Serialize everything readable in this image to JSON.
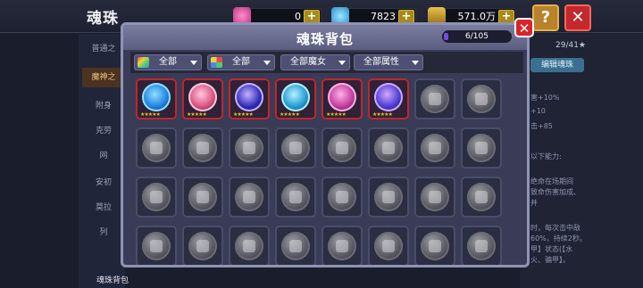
{
  "page": {
    "title": "魂珠"
  },
  "resources": [
    {
      "name": "gem-icon",
      "value": "0",
      "color": "#e05aa8"
    },
    {
      "name": "diamond-icon",
      "value": "7823",
      "color": "#4ac2e8"
    },
    {
      "name": "chest-icon",
      "value": "571.0万",
      "color": "#c79a2a"
    }
  ],
  "top_buttons": {
    "help": "?",
    "close": "✕"
  },
  "sidebar": {
    "items": [
      "普通之",
      "魔神之",
      "附身",
      "克劳",
      "网",
      "安初",
      "莫拉",
      "列"
    ],
    "active_index": 1
  },
  "right_panel": {
    "count": "29/41★",
    "button": "编辑魂珠",
    "lines": [
      "害+10%",
      "+10",
      "击+85",
      "以下能力:",
      "绝命在场期间",
      "致命伤害加成、",
      "并",
      "时，每次击中敌",
      "60%，持续2秒。",
      "甲】状态(【水",
      "火、骗甲】。"
    ]
  },
  "bottom_label": "魂珠背包",
  "modal": {
    "title": "魂珠背包",
    "capacity": "6/105",
    "close_label": "✕",
    "filters": [
      {
        "label": "全部",
        "swatch": "rainbow"
      },
      {
        "label": "全部",
        "swatch": "elements"
      },
      {
        "label": "全部魔女",
        "swatch": ""
      },
      {
        "label": "全部属性",
        "swatch": ""
      }
    ],
    "stars": "★★★★★",
    "orbs": [
      {
        "state": "owned",
        "colors": [
          "#1e7fe0",
          "#8fe0ff"
        ]
      },
      {
        "state": "owned",
        "colors": [
          "#d8507a",
          "#ffc8e0"
        ]
      },
      {
        "state": "owned",
        "colors": [
          "#2a2ab8",
          "#c8b0ff"
        ]
      },
      {
        "state": "owned",
        "colors": [
          "#1e9ad0",
          "#b6f0ff"
        ]
      },
      {
        "state": "owned",
        "colors": [
          "#c23a9a",
          "#ffb0e8"
        ]
      },
      {
        "state": "owned",
        "colors": [
          "#4a3ad0",
          "#d0a8ff"
        ]
      },
      {
        "state": "locked"
      },
      {
        "state": "locked"
      },
      {
        "state": "locked"
      },
      {
        "state": "locked"
      },
      {
        "state": "locked"
      },
      {
        "state": "locked"
      },
      {
        "state": "locked"
      },
      {
        "state": "locked"
      },
      {
        "state": "locked"
      },
      {
        "state": "locked"
      },
      {
        "state": "locked"
      },
      {
        "state": "locked"
      },
      {
        "state": "locked"
      },
      {
        "state": "locked"
      },
      {
        "state": "locked"
      },
      {
        "state": "locked"
      },
      {
        "state": "locked"
      },
      {
        "state": "locked"
      },
      {
        "state": "locked"
      },
      {
        "state": "locked"
      },
      {
        "state": "locked"
      },
      {
        "state": "locked"
      },
      {
        "state": "locked"
      },
      {
        "state": "locked"
      },
      {
        "state": "locked"
      },
      {
        "state": "locked"
      }
    ]
  }
}
